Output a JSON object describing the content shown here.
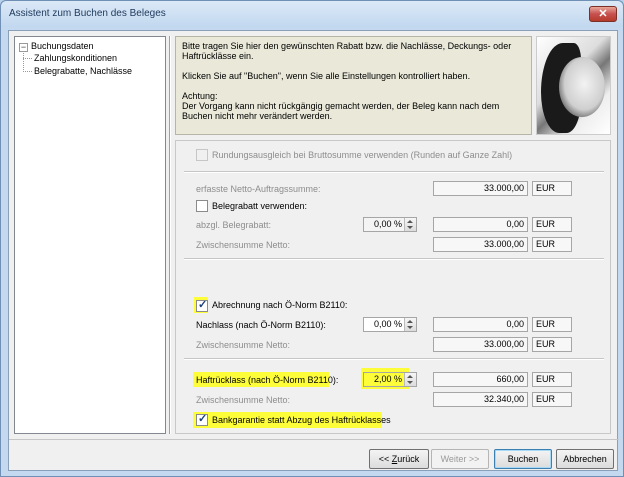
{
  "window": {
    "title": "Assistent zum Buchen des Beleges",
    "close_glyph": "✕"
  },
  "tree": {
    "expander": "−",
    "root": "Buchungsdaten",
    "children": [
      "Zahlungskonditionen",
      "Belegrabatte, Nachlässe"
    ]
  },
  "info": {
    "line1": "Bitte tragen Sie hier den gewünschten Rabatt bzw. die Nachlässe, Deckungs- oder Haftrücklässe ein.",
    "line2": "Klicken Sie auf \"Buchen\", wenn Sie alle Einstellungen kontrolliert haben.",
    "line3": "Achtung:",
    "line4": "Der Vorgang kann nicht rückgängig gemacht werden, der Beleg kann nach dem Buchen nicht mehr verändert werden."
  },
  "form": {
    "rounding": {
      "label": "Rundungsausgleich bei Bruttosumme verwenden (Runden auf Ganze Zahl)",
      "checked": false
    },
    "netto_order": {
      "label": "erfasste Netto-Auftragssumme:",
      "value": "33.000,00",
      "currency": "EUR"
    },
    "belegrabatt": {
      "label": "Belegrabatt verwenden:",
      "checked": false
    },
    "abzgl_rabatt": {
      "label": "abzgl. Belegrabatt:",
      "percent": "0,00 %",
      "value": "0,00",
      "currency": "EUR"
    },
    "subtotal1": {
      "label": "Zwischensumme Netto:",
      "value": "33.000,00",
      "currency": "EUR"
    },
    "onorm": {
      "label": "Abrechnung nach Ö-Norm B2110:",
      "checked": true
    },
    "nachlass": {
      "label": "Nachlass (nach Ö-Norm B2110):",
      "percent": "0,00 %",
      "value": "0,00",
      "currency": "EUR"
    },
    "subtotal2": {
      "label": "Zwischensumme Netto:",
      "value": "33.000,00",
      "currency": "EUR"
    },
    "haftruecklass": {
      "label": "Haftrücklass (nach Ö-Norm B2110):",
      "percent": "2,00 %",
      "value": "660,00",
      "currency": "EUR"
    },
    "subtotal3": {
      "label": "Zwischensumme Netto:",
      "value": "32.340,00",
      "currency": "EUR"
    },
    "bankgarantie": {
      "label": "Bankgarantie statt Abzug des Haftrücklasses",
      "checked": true
    },
    "check_glyph": "✓",
    "highlight_color": "#fdfd3a"
  },
  "buttons": {
    "back_prefix": "<< ",
    "back_key": "Z",
    "back_rest": "urück",
    "next": "Weiter >>",
    "book": "Buchen",
    "cancel": "Abbrechen"
  }
}
